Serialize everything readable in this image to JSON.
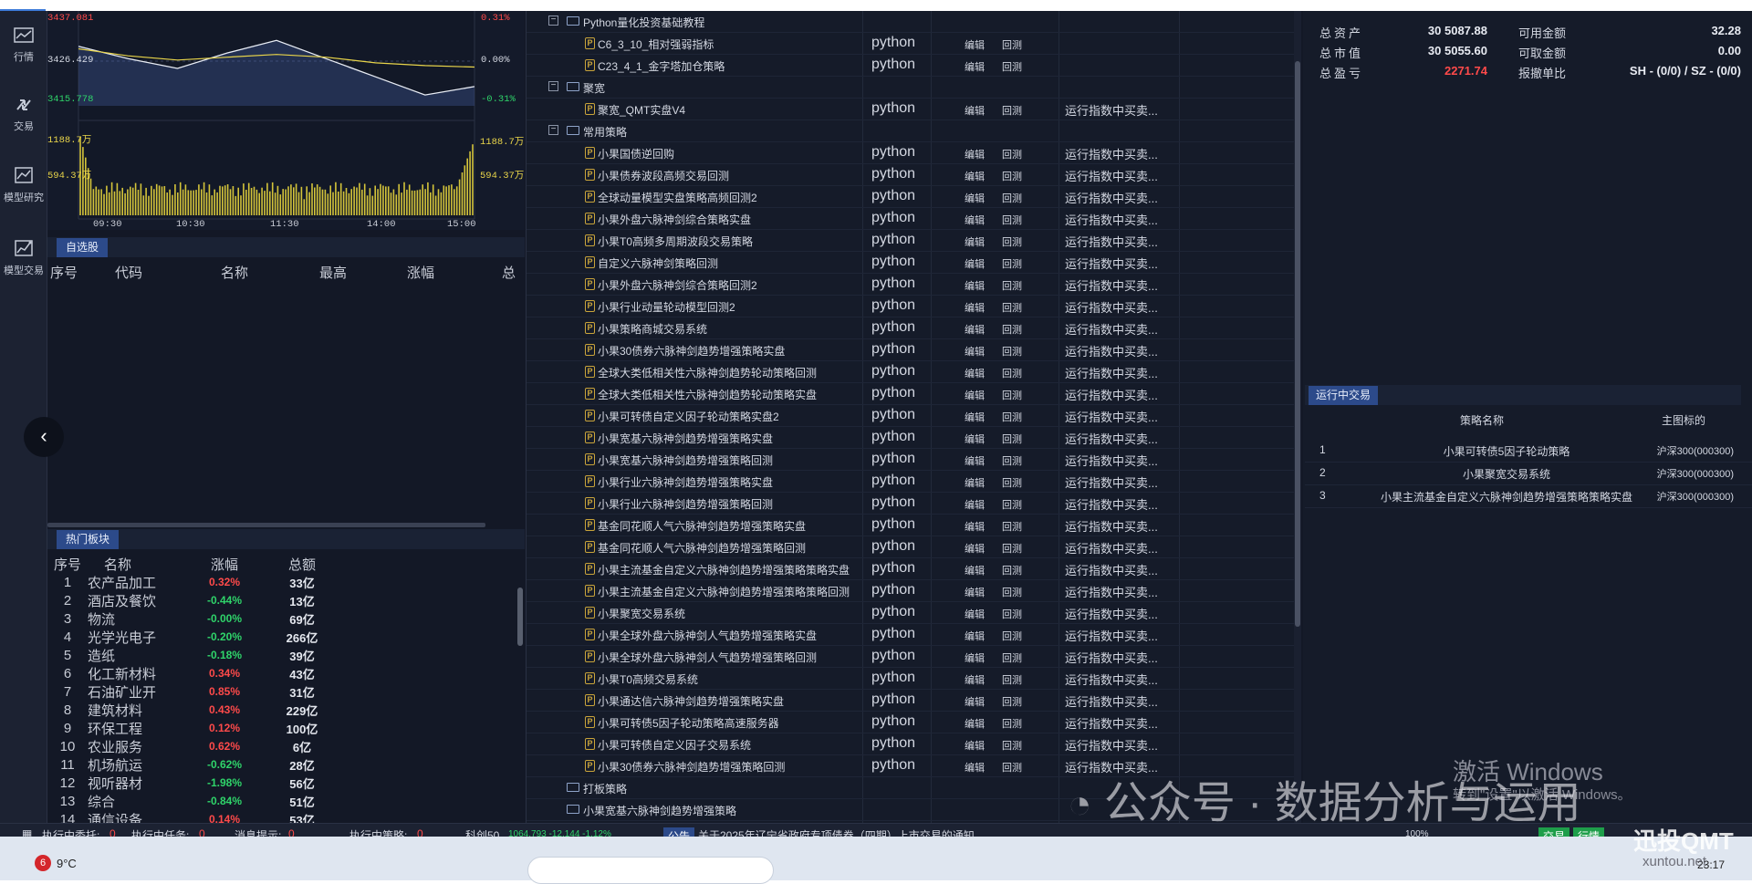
{
  "rail": {
    "items": [
      {
        "label": "行情",
        "icon": "market-chart-icon"
      },
      {
        "label": "交易",
        "icon": "trade-arrows-icon"
      },
      {
        "label": "模型研究",
        "icon": "model-research-icon"
      },
      {
        "label": "模型交易",
        "icon": "model-trade-icon"
      }
    ],
    "collapse": "‹"
  },
  "chart": {
    "price_labels": [
      "3437.081",
      "3426.429",
      "3415.778"
    ],
    "pct_labels": [
      "0.31%",
      "0.00%",
      "-0.31%"
    ],
    "vol_labels": [
      "1188.7万",
      "594.37万"
    ],
    "vol_labels_right": [
      "1188.7万",
      "594.37万"
    ],
    "time_labels": [
      "09:30",
      "10:30",
      "11:30",
      "14:00",
      "15:00"
    ]
  },
  "chart_data": {
    "type": "line",
    "title": "",
    "x": [
      "09:30",
      "10:30",
      "11:30",
      "14:00",
      "15:00"
    ],
    "ylim": [
      3405.126,
      3437.081
    ],
    "series": [
      {
        "values": [
          3426.4,
          3422.0,
          3418.5,
          3424.0,
          3428.5,
          3422.0,
          3415.5,
          3409.0,
          3412.0
        ]
      },
      {
        "values": [
          3425.5,
          3423.0,
          3421.5,
          3422.5,
          3423.5,
          3422.5,
          3420.5,
          3419.5,
          3419.0
        ]
      }
    ],
    "volume_ylim": [
      0,
      1188.7
    ],
    "volume_unit": "万"
  },
  "watchlist": {
    "tab": "自选股",
    "columns": [
      "序号",
      "代码",
      "名称",
      "最高",
      "涨幅",
      "总额"
    ]
  },
  "hot": {
    "tab": "热门板块",
    "columns": [
      "序号",
      "名称",
      "涨幅",
      "总额"
    ],
    "rows": [
      {
        "no": "1",
        "name": "农产品加工",
        "chg": "0.32%",
        "vol": "33亿",
        "dir": "up"
      },
      {
        "no": "2",
        "name": "酒店及餐饮",
        "chg": "-0.44%",
        "vol": "13亿",
        "dir": "down"
      },
      {
        "no": "3",
        "name": "物流",
        "chg": "-0.00%",
        "vol": "69亿",
        "dir": "down"
      },
      {
        "no": "4",
        "name": "光学光电子",
        "chg": "-0.20%",
        "vol": "266亿",
        "dir": "down"
      },
      {
        "no": "5",
        "name": "造纸",
        "chg": "-0.18%",
        "vol": "39亿",
        "dir": "down"
      },
      {
        "no": "6",
        "name": "化工新材料",
        "chg": "0.34%",
        "vol": "43亿",
        "dir": "up"
      },
      {
        "no": "7",
        "name": "石油矿业开",
        "chg": "0.85%",
        "vol": "31亿",
        "dir": "up"
      },
      {
        "no": "8",
        "name": "建筑材料",
        "chg": "0.43%",
        "vol": "229亿",
        "dir": "up"
      },
      {
        "no": "9",
        "name": "环保工程",
        "chg": "0.12%",
        "vol": "100亿",
        "dir": "up"
      },
      {
        "no": "10",
        "name": "农业服务",
        "chg": "0.62%",
        "vol": "6亿",
        "dir": "up"
      },
      {
        "no": "11",
        "name": "机场航运",
        "chg": "-0.62%",
        "vol": "28亿",
        "dir": "down"
      },
      {
        "no": "12",
        "name": "视听器材",
        "chg": "-1.98%",
        "vol": "56亿",
        "dir": "down"
      },
      {
        "no": "13",
        "name": "综合",
        "chg": "-0.84%",
        "vol": "51亿",
        "dir": "down"
      },
      {
        "no": "14",
        "name": "通信设备",
        "chg": "0.14%",
        "vol": "53亿",
        "dir": "up"
      }
    ]
  },
  "tree": {
    "edit": "编辑",
    "backtest": "回测",
    "rows": [
      {
        "type": "folder",
        "level": 0,
        "name": "Python量化投资基础教程",
        "expanded": true
      },
      {
        "type": "file",
        "level": 1,
        "name": "C6_3_10_相对强弱指标",
        "lang": "python",
        "run": ""
      },
      {
        "type": "file",
        "level": 1,
        "name": "C23_4_1_金字塔加仓策略",
        "lang": "python",
        "run": ""
      },
      {
        "type": "folder",
        "level": 0,
        "name": "聚宽",
        "expanded": true
      },
      {
        "type": "file",
        "level": 1,
        "name": "聚宽_QMT实盘V4",
        "lang": "python",
        "run": "运行指数中买卖..."
      },
      {
        "type": "folder",
        "level": 0,
        "name": "常用策略",
        "expanded": true
      },
      {
        "type": "file",
        "level": 1,
        "name": "小果国债逆回购",
        "lang": "python",
        "run": "运行指数中买卖..."
      },
      {
        "type": "file",
        "level": 1,
        "name": "小果债券波段高频交易回测",
        "lang": "python",
        "run": "运行指数中买卖..."
      },
      {
        "type": "file",
        "level": 1,
        "name": "全球动量模型实盘策略高频回测2",
        "lang": "python",
        "run": "运行指数中买卖..."
      },
      {
        "type": "file",
        "level": 1,
        "name": "小果外盘六脉神剑综合策略实盘",
        "lang": "python",
        "run": "运行指数中买卖..."
      },
      {
        "type": "file",
        "level": 1,
        "name": "小果T0高频多周期波段交易策略",
        "lang": "python",
        "run": "运行指数中买卖..."
      },
      {
        "type": "file",
        "level": 1,
        "name": "自定义六脉神剑策略回测",
        "lang": "python",
        "run": "运行指数中买卖..."
      },
      {
        "type": "file",
        "level": 1,
        "name": "小果外盘六脉神剑综合策略回测2",
        "lang": "python",
        "run": "运行指数中买卖..."
      },
      {
        "type": "file",
        "level": 1,
        "name": "小果行业动量轮动模型回测2",
        "lang": "python",
        "run": "运行指数中买卖..."
      },
      {
        "type": "file",
        "level": 1,
        "name": "小果策略商城交易系统",
        "lang": "python",
        "run": "运行指数中买卖..."
      },
      {
        "type": "file",
        "level": 1,
        "name": "小果30债券六脉神剑趋势增强策略实盘",
        "lang": "python",
        "run": "运行指数中买卖..."
      },
      {
        "type": "file",
        "level": 1,
        "name": "全球大类低相关性六脉神剑趋势轮动策略回测",
        "lang": "python",
        "run": "运行指数中买卖..."
      },
      {
        "type": "file",
        "level": 1,
        "name": "全球大类低相关性六脉神剑趋势轮动策略实盘",
        "lang": "python",
        "run": "运行指数中买卖..."
      },
      {
        "type": "file",
        "level": 1,
        "name": "小果可转债自定义因子轮动策略实盘2",
        "lang": "python",
        "run": "运行指数中买卖..."
      },
      {
        "type": "file",
        "level": 1,
        "name": "小果宽基六脉神剑趋势增强策略实盘",
        "lang": "python",
        "run": "运行指数中买卖..."
      },
      {
        "type": "file",
        "level": 1,
        "name": "小果宽基六脉神剑趋势增强策略回测",
        "lang": "python",
        "run": "运行指数中买卖..."
      },
      {
        "type": "file",
        "level": 1,
        "name": "小果行业六脉神剑趋势增强策略实盘",
        "lang": "python",
        "run": "运行指数中买卖..."
      },
      {
        "type": "file",
        "level": 1,
        "name": "小果行业六脉神剑趋势增强策略回测",
        "lang": "python",
        "run": "运行指数中买卖..."
      },
      {
        "type": "file",
        "level": 1,
        "name": "基金同花顺人气六脉神剑趋势增强策略实盘",
        "lang": "python",
        "run": "运行指数中买卖..."
      },
      {
        "type": "file",
        "level": 1,
        "name": "基金同花顺人气六脉神剑趋势增强策略回测",
        "lang": "python",
        "run": "运行指数中买卖..."
      },
      {
        "type": "file",
        "level": 1,
        "name": "小果主流基金自定义六脉神剑趋势增强策略策略实盘",
        "lang": "python",
        "run": "运行指数中买卖..."
      },
      {
        "type": "file",
        "level": 1,
        "name": "小果主流基金自定义六脉神剑趋势增强策略策略回测",
        "lang": "python",
        "run": "运行指数中买卖..."
      },
      {
        "type": "file",
        "level": 1,
        "name": "小果聚宽交易系统",
        "lang": "python",
        "run": "运行指数中买卖..."
      },
      {
        "type": "file",
        "level": 1,
        "name": "小果全球外盘六脉神剑人气趋势增强策略实盘",
        "lang": "python",
        "run": "运行指数中买卖..."
      },
      {
        "type": "file",
        "level": 1,
        "name": "小果全球外盘六脉神剑人气趋势增强策略回测",
        "lang": "python",
        "run": "运行指数中买卖..."
      },
      {
        "type": "file",
        "level": 1,
        "name": "小果T0高频交易系统",
        "lang": "python",
        "run": "运行指数中买卖..."
      },
      {
        "type": "file",
        "level": 1,
        "name": "小果通达信六脉神剑趋势增强策略实盘",
        "lang": "python",
        "run": "运行指数中买卖..."
      },
      {
        "type": "file",
        "level": 1,
        "name": "小果可转债5因子轮动策略高速服务器",
        "lang": "python",
        "run": "运行指数中买卖..."
      },
      {
        "type": "file",
        "level": 1,
        "name": "小果可转债自定义因子交易系统",
        "lang": "python",
        "run": "运行指数中买卖..."
      },
      {
        "type": "file",
        "level": 1,
        "name": "小果30债券六脉神剑趋势增强策略回测",
        "lang": "python",
        "run": "运行指数中买卖..."
      },
      {
        "type": "folder",
        "level": 0,
        "name": "打板策略",
        "expanded": false
      },
      {
        "type": "folder",
        "level": 0,
        "name": "小果宽基六脉神剑趋势增强策略",
        "expanded": false
      }
    ]
  },
  "account": {
    "rows": [
      {
        "label": "总资产",
        "value": "30 5087.88",
        "label2": "可用金额",
        "value2": "32.28",
        "value_color": "#e8ebf2"
      },
      {
        "label": "总市值",
        "value": "30 5055.60",
        "label2": "可取金额",
        "value2": "0.00",
        "value_color": "#e8ebf2"
      },
      {
        "label": "总盈亏",
        "value": "2271.74",
        "label2": "报撤单比",
        "value2": "SH - (0/0) / SZ - (0/0)",
        "value_color": "#ff4a4a"
      }
    ]
  },
  "running": {
    "tab": "运行中交易",
    "columns": [
      "策略名称",
      "主图标的"
    ],
    "rows": [
      {
        "no": "1",
        "name": "小果可转债5因子轮动策略",
        "target": "沪深300(000300)"
      },
      {
        "no": "2",
        "name": "小果聚宽交易系统",
        "target": "沪深300(000300)"
      },
      {
        "no": "3",
        "name": "小果主流基金自定义六脉神剑趋势增强策略策略实盘",
        "target": "沪深300(000300)"
      }
    ]
  },
  "status": {
    "entrust_label": "执行中委托:",
    "entrust_val": "0",
    "task_label": "执行中任务:",
    "task_val": "0",
    "msg_label": "消息提示:",
    "msg_val": "0",
    "strategy_label": "执行中策略:",
    "strategy_val": "0",
    "ticker": "科创50",
    "ticker_vals": "1064.793 -12.144 -1.12%",
    "notice_tag": "公告",
    "notice": "关于2025年辽宁省政府专项债券（四期）上市交易的通知",
    "zoom": "100%",
    "btn_trade": "交易",
    "btn_market": "行情"
  },
  "taskbar": {
    "badge": "6",
    "weather": "9°C",
    "time": "23:17"
  },
  "watermarks": {
    "activate": "激活 Windows",
    "activate_sub": "转到\"设置\"以激活 Windows。",
    "wechat": "公众号 · 数据分析与运用",
    "brand": "迅投QMT",
    "site": "xuntou.net"
  }
}
